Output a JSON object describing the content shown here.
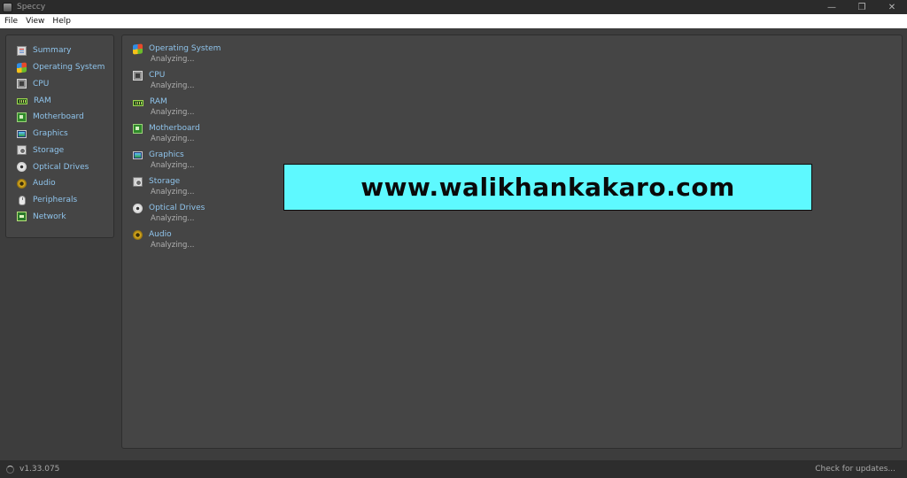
{
  "window": {
    "title": "Speccy",
    "minimize": "—",
    "maximize": "❐",
    "close": "✕"
  },
  "menu": [
    "File",
    "View",
    "Help"
  ],
  "sidebar": {
    "items": [
      {
        "label": "Summary",
        "icon": "summary-icon"
      },
      {
        "label": "Operating System",
        "icon": "os-icon"
      },
      {
        "label": "CPU",
        "icon": "cpu-icon"
      },
      {
        "label": "RAM",
        "icon": "ram-icon"
      },
      {
        "label": "Motherboard",
        "icon": "motherboard-icon"
      },
      {
        "label": "Graphics",
        "icon": "graphics-icon"
      },
      {
        "label": "Storage",
        "icon": "storage-icon"
      },
      {
        "label": "Optical Drives",
        "icon": "optical-drive-icon"
      },
      {
        "label": "Audio",
        "icon": "audio-icon"
      },
      {
        "label": "Peripherals",
        "icon": "peripherals-icon"
      },
      {
        "label": "Network",
        "icon": "network-icon"
      }
    ]
  },
  "content": {
    "sections": [
      {
        "title": "Operating System",
        "status": "Analyzing..."
      },
      {
        "title": "CPU",
        "status": "Analyzing..."
      },
      {
        "title": "RAM",
        "status": "Analyzing..."
      },
      {
        "title": "Motherboard",
        "status": "Analyzing..."
      },
      {
        "title": "Graphics",
        "status": "Analyzing..."
      },
      {
        "title": "Storage",
        "status": "Analyzing..."
      },
      {
        "title": "Optical Drives",
        "status": "Analyzing..."
      },
      {
        "title": "Audio",
        "status": "Analyzing..."
      }
    ]
  },
  "watermark": {
    "text": "www.walikhankakaro.com"
  },
  "status": {
    "version": "v1.33.075",
    "updates": "Check for updates..."
  },
  "colors": {
    "link": "#8fc4ec",
    "background": "#3d3d3d",
    "panel": "#454545",
    "banner": "#5ef9ff"
  }
}
